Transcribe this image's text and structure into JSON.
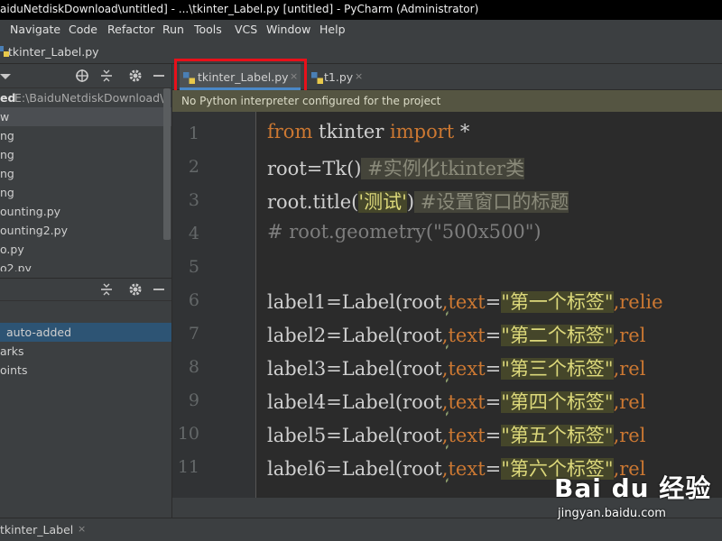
{
  "window": {
    "title": "aiduNetdiskDownload\\untitled] - ...\\tkinter_Label.py [untitled] - PyCharm (Administrator)"
  },
  "menu": {
    "items": [
      {
        "label": "Navigate"
      },
      {
        "label": "Code"
      },
      {
        "label": "Refactor"
      },
      {
        "label": "Run"
      },
      {
        "label": "Tools"
      },
      {
        "label": "VCS"
      },
      {
        "label": "Window"
      },
      {
        "label": "Help"
      }
    ]
  },
  "navbar": {
    "file": "tkinter_Label.py"
  },
  "project_tree": {
    "root_label": "ed",
    "root_path": "E:\\BaiduNetdiskDownload\\untitled",
    "items": [
      "w",
      "ng",
      "ng",
      "ng",
      "ng",
      "ounting.py",
      "ounting2.py",
      "o.py",
      "o2.py"
    ]
  },
  "bottom_tree": {
    "items": [
      "auto-added",
      "arks",
      "oints"
    ]
  },
  "tabs": [
    {
      "label": "tkinter_Label.py",
      "active": true,
      "close": "×"
    },
    {
      "label": "t1.py",
      "active": false,
      "close": "×"
    }
  ],
  "warning": {
    "text": "No Python interpreter configured for the project"
  },
  "editor": {
    "line_numbers": [
      "1",
      "2",
      "3",
      "4",
      "5",
      "6",
      "7",
      "8",
      "9",
      "10",
      "11"
    ],
    "code": {
      "l1_kw1": "from",
      "l1_mid": " tkinter ",
      "l1_kw2": "import",
      "l1_end": " *",
      "l2_a": "root=Tk()",
      "l2_comment": " #实例化tkinter类",
      "l3_a": "root.title(",
      "l3_str": "'测试'",
      "l3_b": ")",
      "l3_comment": " #设置窗口的标题",
      "l4_comment": "# root.geometry(\"500x500\")",
      "labels": [
        {
          "var": "label1",
          "text": "\"第一个标签\"",
          "rest": ",relie"
        },
        {
          "var": "label2",
          "text": "\"第二个标签\"",
          "rest": ",rel"
        },
        {
          "var": "label3",
          "text": "\"第三个标签\"",
          "rest": ",rel"
        },
        {
          "var": "label4",
          "text": "\"第四个标签\"",
          "rest": ",rel"
        },
        {
          "var": "label5",
          "text": "\"第五个标签\"",
          "rest": ",rel"
        },
        {
          "var": "label6",
          "text": "\"第六个标签\"",
          "rest": ",rel"
        }
      ],
      "eq_label": "=Label(root",
      "comma": ",",
      "param_text": "text",
      "eq": "="
    }
  },
  "statusbar": {
    "tool_window": "tkinter_Label",
    "close": "×"
  },
  "watermark": {
    "brand": "Bai du 经验",
    "url": "jingyan.baidu.com"
  },
  "colors": {
    "keyword": "#cc7832",
    "string": "#dcd87a",
    "comment": "#7e7e7e",
    "tab_underline": "#4a88c7",
    "highlight_box": "#e8101a"
  }
}
